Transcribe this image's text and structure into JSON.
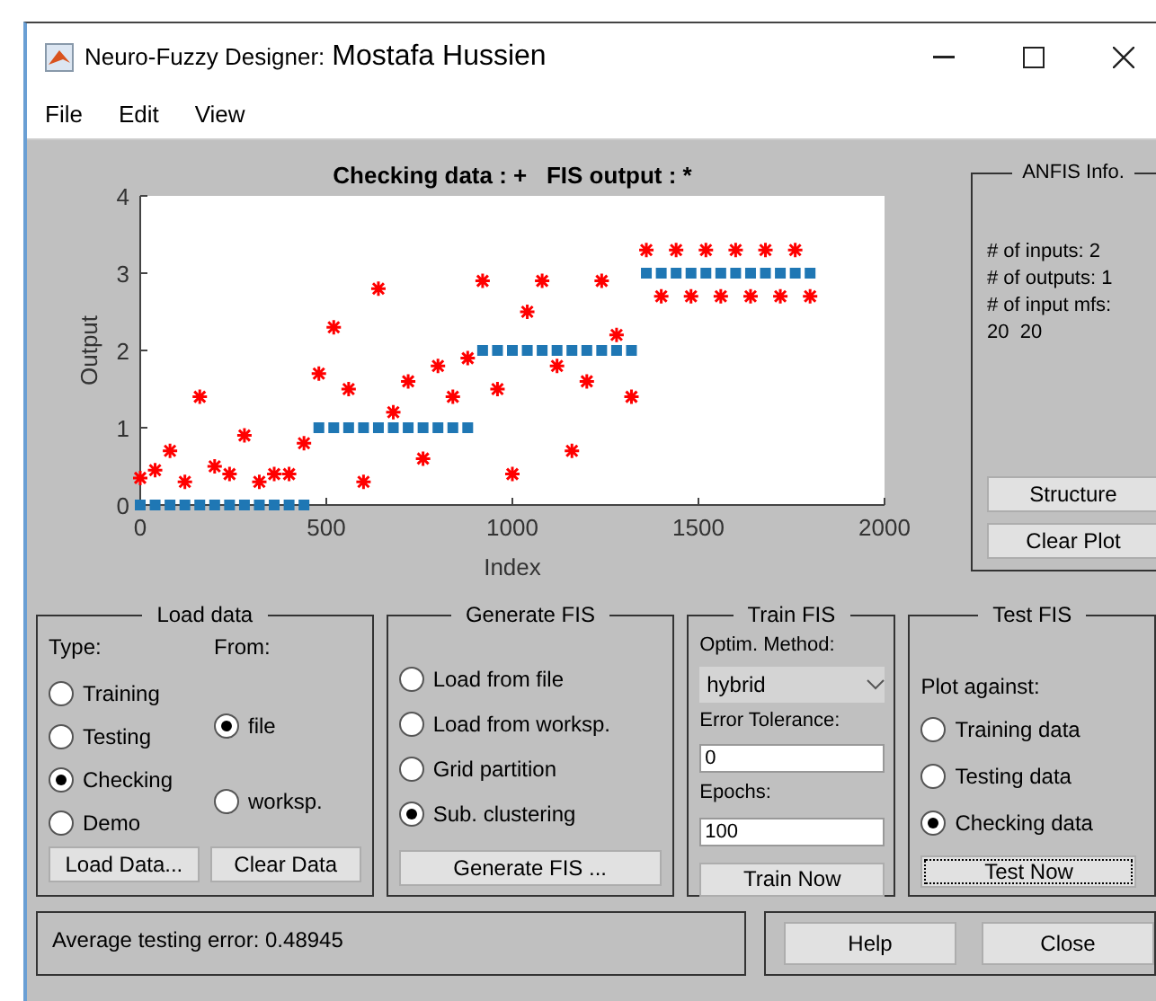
{
  "window": {
    "title": "Neuro-Fuzzy Designer:",
    "subtitle": "Mostafa Hussien"
  },
  "menu": [
    "File",
    "Edit",
    "View"
  ],
  "plot": {
    "chart_data": {
      "type": "scatter",
      "title": "Checking data : +   FIS output : *",
      "xlabel": "Index",
      "ylabel": "Output",
      "xlim": [
        0,
        2000
      ],
      "ylim": [
        0,
        4
      ],
      "xticks": [
        0,
        500,
        1000,
        1500,
        2000
      ],
      "yticks": [
        0,
        1,
        2,
        3,
        4
      ],
      "x": [
        0,
        40,
        80,
        120,
        160,
        200,
        240,
        280,
        320,
        360,
        400,
        440,
        480,
        520,
        560,
        600,
        640,
        680,
        720,
        760,
        800,
        840,
        880,
        920,
        960,
        1000,
        1040,
        1080,
        1120,
        1160,
        1200,
        1240,
        1280,
        1320,
        1360,
        1400,
        1440,
        1480,
        1520,
        1560,
        1600,
        1640,
        1680,
        1720,
        1760,
        1800
      ],
      "series": [
        {
          "color": "#1f77b4",
          "values": [
            0,
            0,
            0,
            0,
            0,
            0,
            0,
            0,
            0,
            0,
            0,
            0,
            1,
            1,
            1,
            1,
            1,
            1,
            1,
            1,
            1,
            1,
            1,
            2,
            2,
            2,
            2,
            2,
            2,
            2,
            2,
            2,
            2,
            2,
            3,
            3,
            3,
            3,
            3,
            3,
            3,
            3,
            3,
            3,
            3,
            3
          ]
        },
        {
          "color": "#ff0000",
          "values": [
            0.35,
            0.45,
            0.7,
            0.3,
            1.4,
            0.5,
            0.4,
            0.9,
            0.3,
            0.4,
            0.4,
            0.8,
            1.7,
            2.3,
            1.5,
            0.3,
            2.8,
            1.2,
            1.6,
            0.6,
            1.8,
            1.4,
            1.9,
            2.9,
            1.5,
            0.4,
            2.5,
            2.9,
            1.8,
            0.7,
            1.6,
            2.9,
            2.2,
            1.4,
            3.3,
            2.7,
            3.3,
            2.7,
            3.3,
            2.7,
            3.3,
            2.7,
            3.3,
            2.7,
            3.3,
            2.7
          ]
        }
      ]
    }
  },
  "anfis_info": {
    "title": "ANFIS Info.",
    "lines": [
      "# of inputs: 2",
      "# of outputs: 1",
      "# of input mfs:",
      "20  20"
    ],
    "buttons": [
      "Structure",
      "Clear Plot"
    ]
  },
  "load_data": {
    "title": "Load data",
    "type_label": "Type:",
    "from_label": "From:",
    "type_options": [
      {
        "label": "Training",
        "selected": false
      },
      {
        "label": "Testing",
        "selected": false
      },
      {
        "label": "Checking",
        "selected": true
      },
      {
        "label": "Demo",
        "selected": false
      }
    ],
    "from_options": [
      {
        "label": "file",
        "selected": true
      },
      {
        "label": "worksp.",
        "selected": false
      }
    ],
    "buttons": [
      "Load Data...",
      "Clear Data"
    ]
  },
  "generate_fis": {
    "title": "Generate FIS",
    "options": [
      {
        "label": "Load from file",
        "selected": false
      },
      {
        "label": "Load from worksp.",
        "selected": false
      },
      {
        "label": "Grid partition",
        "selected": false
      },
      {
        "label": "Sub. clustering",
        "selected": true
      }
    ],
    "button": "Generate FIS ..."
  },
  "train_fis": {
    "title": "Train FIS",
    "method_label": "Optim. Method:",
    "method": "hybrid",
    "tolerance_label": "Error Tolerance:",
    "tolerance": "0",
    "epochs_label": "Epochs:",
    "epochs": "100",
    "button": "Train Now"
  },
  "test_fis": {
    "title": "Test FIS",
    "plot_label": "Plot against:",
    "options": [
      {
        "label": "Training data",
        "selected": false
      },
      {
        "label": "Testing data",
        "selected": false
      },
      {
        "label": "Checking data",
        "selected": true
      }
    ],
    "button": {
      "label": "Test Now",
      "focused": true
    }
  },
  "status": "Average testing error: 0.48945",
  "buttons": [
    "Help",
    "Close"
  ]
}
